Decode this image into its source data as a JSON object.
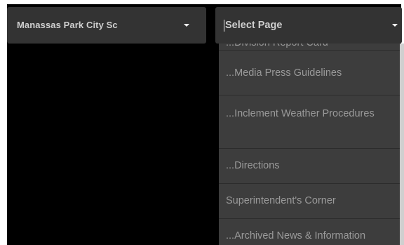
{
  "site_select": {
    "value": "Manassas Park City Sc",
    "caret_icon": "caret-down-icon"
  },
  "page_select": {
    "value": "Select Page",
    "caret_icon": "caret-down-icon"
  },
  "dropdown": {
    "items": [
      {
        "label": "...Division Report Card"
      },
      {
        "label": "...Media Press Guidelines"
      },
      {
        "label": "...Inclement Weather Procedures"
      },
      {
        "label": "...Directions"
      },
      {
        "label": "Superintendent's Corner"
      },
      {
        "label": "...Archived News & Information"
      }
    ]
  },
  "colors": {
    "select_background": "#333333",
    "dropdown_background": "#3d3d3d",
    "text": "#cfcfcf",
    "menu_text": "#9a9a9a"
  }
}
